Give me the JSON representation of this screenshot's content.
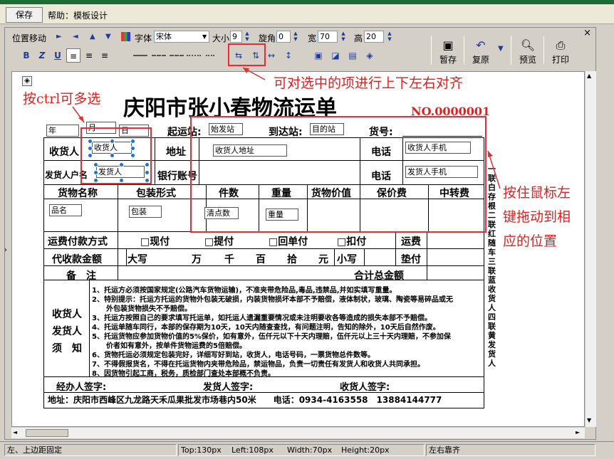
{
  "toolbar_top": {
    "save": "保存",
    "help": "帮助：模板设计"
  },
  "toolbar": {
    "move_label": "位置移动",
    "font_label": "字体",
    "font_value": "宋体",
    "size_label": "大小",
    "size_value": "9",
    "rotate_label": "旋角",
    "rotate_value": "0",
    "width_label": "宽",
    "width_value": "70",
    "height_label": "高",
    "height_value": "20",
    "bold": "B",
    "italic": "Z",
    "underline": "U",
    "temp_save": "暂存",
    "restore": "复原",
    "preview": "预览",
    "print": "打印"
  },
  "status": {
    "left_text": "左、上边距固定",
    "top": "Top:130px",
    "left": "Left:108px",
    "width": "Width:70px",
    "height": "Height:20px",
    "right_text": "左右靠齐"
  },
  "annotations": {
    "multi_select": "按ctrl可多选",
    "align": "可对选中的项进行上下左右对齐",
    "drag": [
      "按住鼠标左",
      "键拖动到相",
      "应的位置"
    ]
  },
  "form": {
    "title": "庆阳市张小春物流运单",
    "number": "NO.0000001",
    "year": "年",
    "month": "月",
    "day": "日",
    "origin_label": "起运站:",
    "origin_field": "始发站",
    "dest_label": "到达站:",
    "dest_field": "目的站",
    "cargo_no_label": "货号:",
    "receiver_label": "收货人",
    "receiver_field": "收货人",
    "address_label": "地址",
    "address_field": "收货人地址",
    "phone_label": "电话",
    "phone_field1": "收货人手机",
    "sender_label": "发货人户名",
    "sender_field": "发货人",
    "bank_label": "银行账号",
    "phone_field2": "发货人手机",
    "col_goods": "货物名称",
    "col_pack": "包装形式",
    "col_count": "件数",
    "col_weight": "重量",
    "col_value": "货物价值",
    "col_insure": "保价费",
    "col_transfer": "中转费",
    "goods_field": "品名",
    "pack_field": "包装",
    "count_field": "清点数",
    "weight_field": "重量",
    "pay_label": "运费付款方式",
    "pay_cash": "□现付",
    "pay_pickup": "□提付",
    "pay_return": "□回单付",
    "pay_deduct": "□扣付",
    "freight": "运费",
    "cod_label": "代收款金额",
    "capital": "大写",
    "wan": "万",
    "qian": "千",
    "bai": "百",
    "shi": "拾",
    "yuan": "元",
    "lower": "小写",
    "advance": "垫付",
    "remark": "备　注",
    "total": "合计总金额",
    "notice_title": [
      "收货人",
      "发货人",
      "须　知"
    ],
    "notices": [
      "1、托运方必须按国家规定(公路汽车货物运输)，不准夹带危险品,毒品,违禁品,并如实填写重量。",
      "2、特别提示：托运方托运的货物外包装无破损，内装货物损坏本部不予赔偿，液体制状，玻璃、陶瓷等易碎品或无",
      "　　外包装货物损失不予赔偿。",
      "3、托运方按照自己的要求填写托运单，如托运人遗漏重要情况或未注明要收各等造成的损失本部不予赔偿。",
      "4、托运单随车同行，本部的保存期为10天，10天内随查查找，有问题注明，告知的除外，10天后自然作废。",
      "5、托运货物应参加货物价值的5%保价，如有意外，伍仟元以下十天内理赔，伍仟元以上三十天内理赔，不参加保",
      "　　价者如有意外，按单件货物运费的5倍赔偿。",
      "6、货物托运必须规定包装完好，详细写好到站，收货人，电话号码，一票货物总件数等。",
      "7、不得假报货名，不得在托运货物内夹带危险品，禁运物品，负责一切责任有发货人和收货人共同承担。",
      "8、因货物引起工商，税务，质检部门查处本部概不负责。"
    ],
    "agent_sign": "经办人签字:",
    "sender_sign": "发货人签字:",
    "receiver_sign": "收货人签字:",
    "footer": "地址：庆阳市西峰区九龙路天禾瓜果批发市场巷内50米　　电话：0934-4163558　13884144777",
    "side_text": "一联白存根　二联红随车　三联蓝收货人　四联黄发货人"
  }
}
